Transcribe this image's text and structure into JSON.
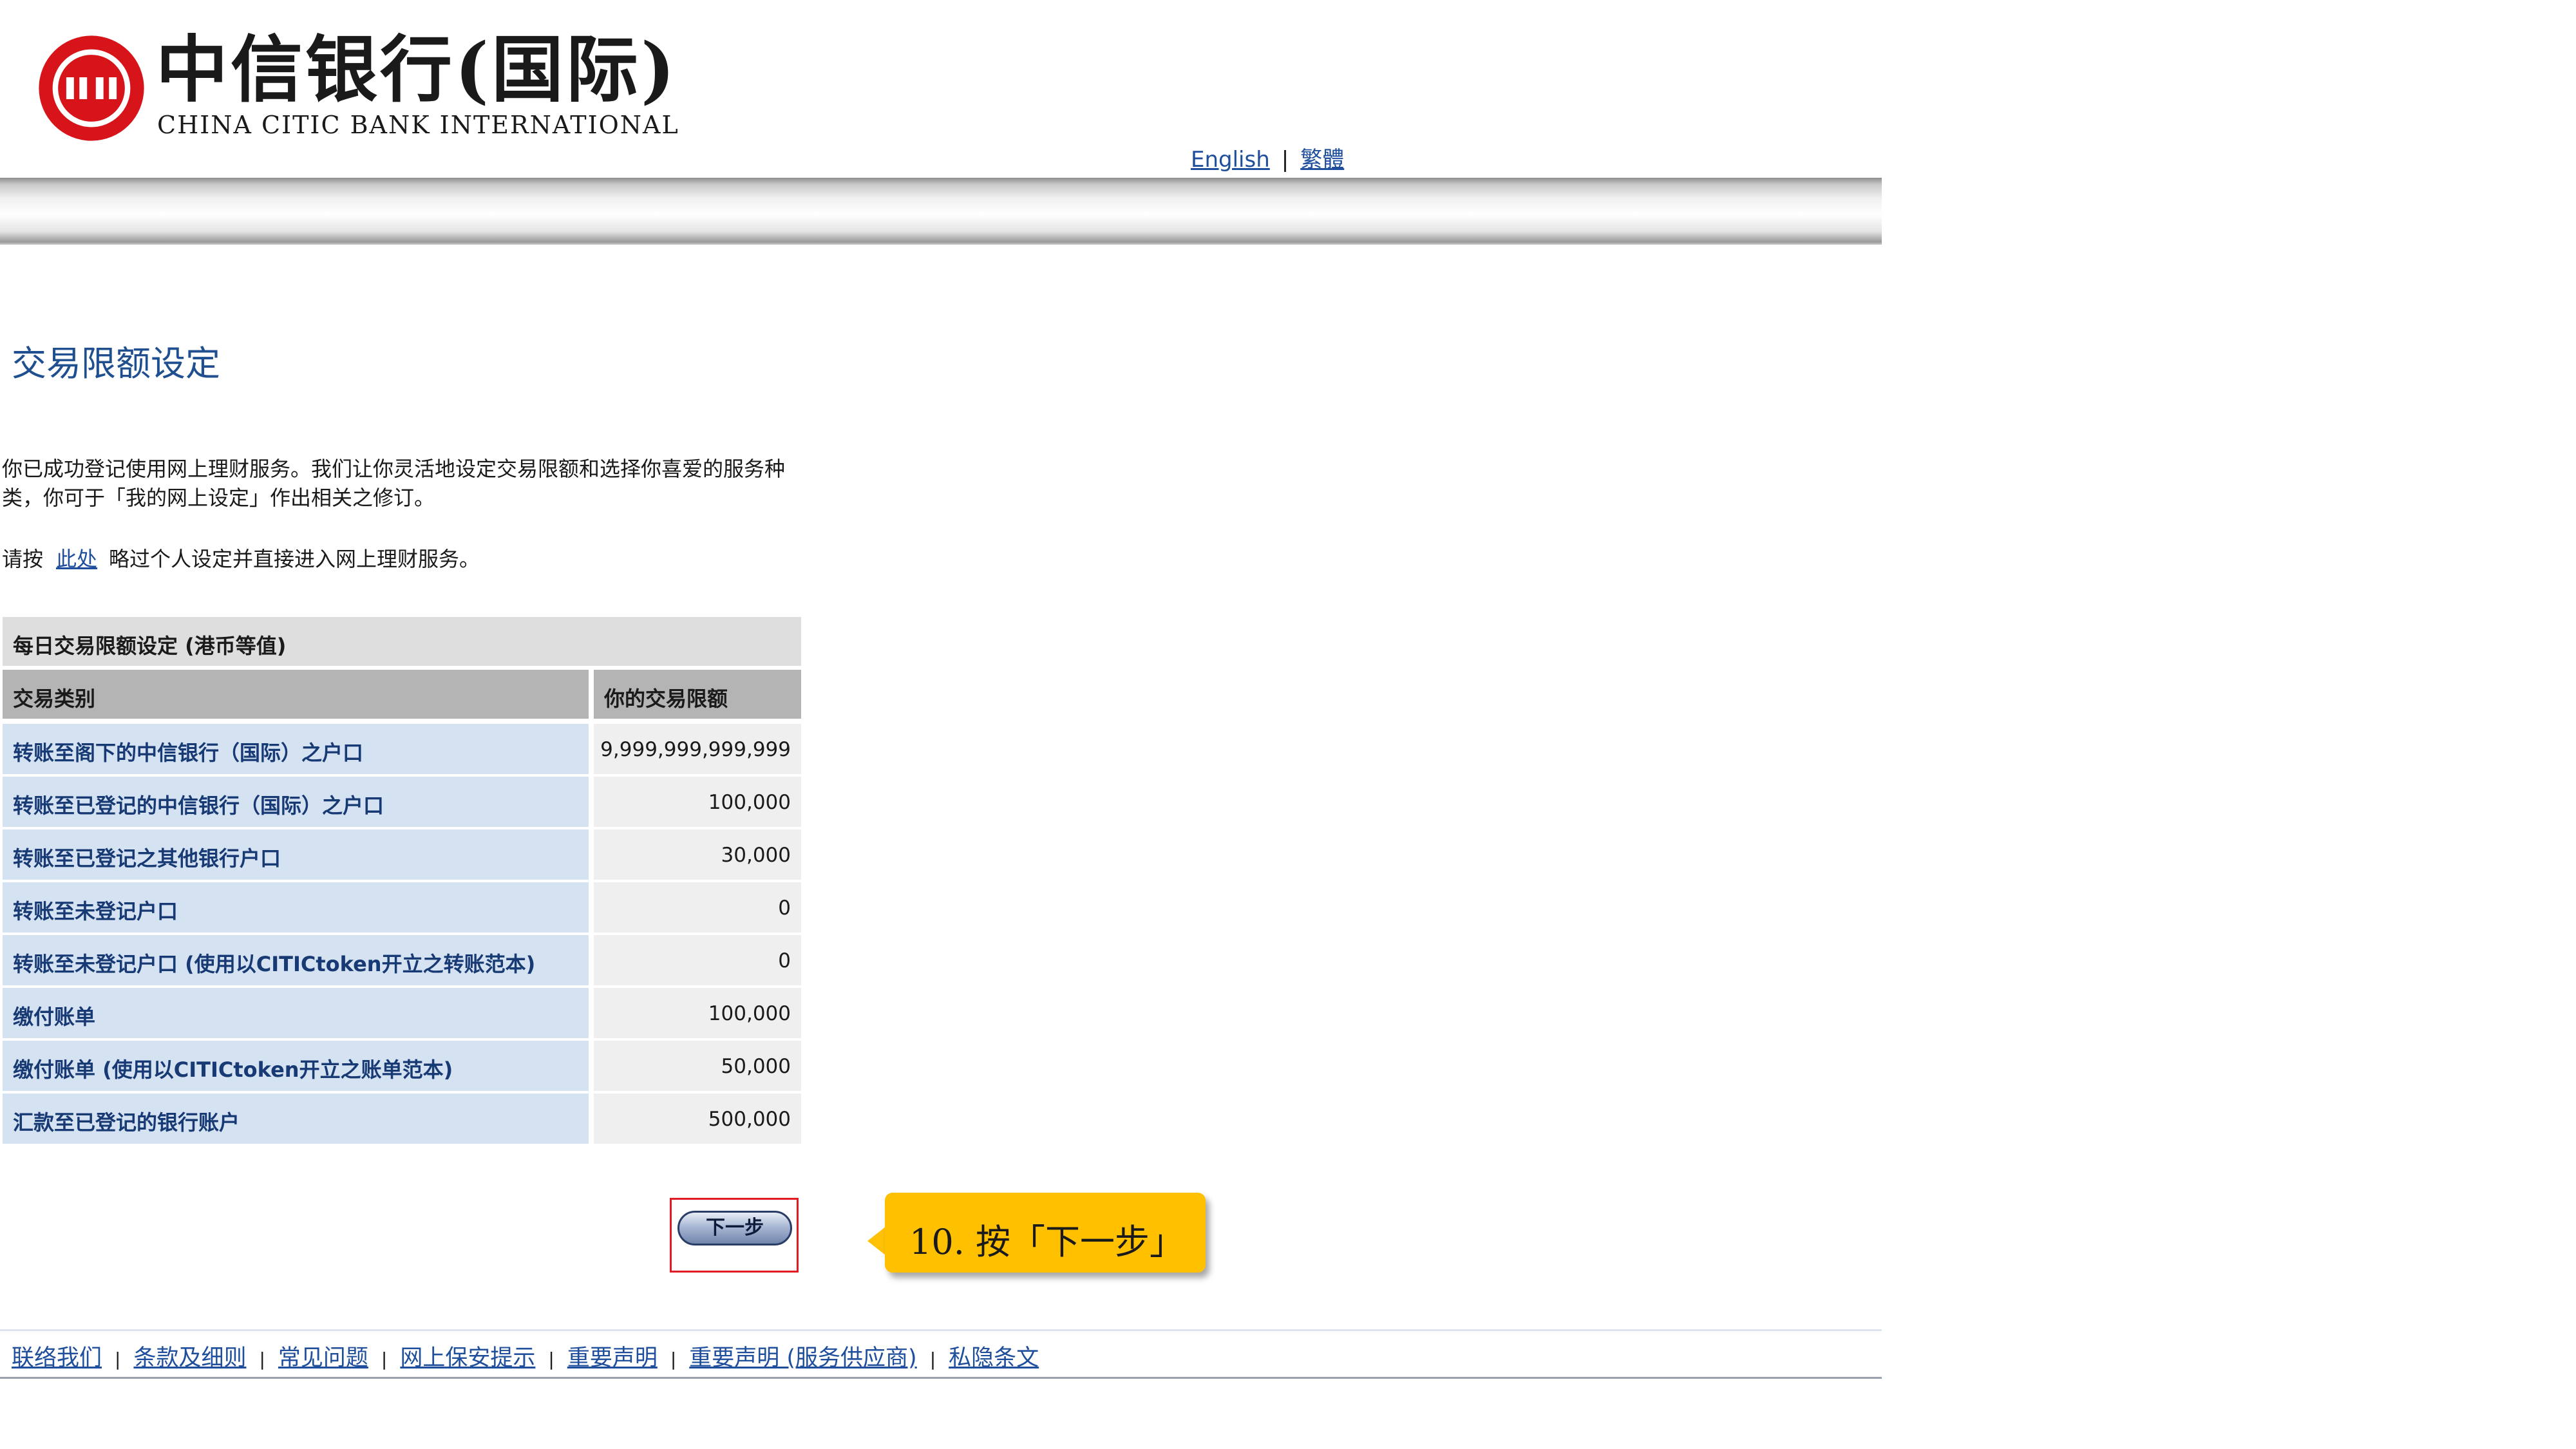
{
  "brand": {
    "name_cn": "中信银行(国际)",
    "name_en": "CHINA CITIC BANK INTERNATIONAL",
    "logo_icon": "citic-logo-icon",
    "color": "#d7141a"
  },
  "lang": {
    "english": "English",
    "traditional": "繁體",
    "separator": "|"
  },
  "page": {
    "title": "交易限额设定",
    "intro": "你已成功登记使用网上理财服务。我们让你灵活地设定交易限额和选择你喜爱的服务种类，你可于「我的网上设定」作出相关之修订。",
    "skip_prefix": "请按",
    "skip_link": "此处",
    "skip_suffix": "略过个人设定并直接进入网上理财服务。"
  },
  "table": {
    "caption": "每日交易限额设定 (港币等值)",
    "col_type": "交易类别",
    "col_limit": "你的交易限额",
    "rows": [
      {
        "type": "转账至阁下的中信银行（国际）之户口",
        "limit": "9,999,999,999,999"
      },
      {
        "type": "转账至已登记的中信银行（国际）之户口",
        "limit": "100,000"
      },
      {
        "type": "转账至已登记之其他银行户口",
        "limit": "30,000"
      },
      {
        "type": "转账至未登记户口",
        "limit": "0"
      },
      {
        "type": "转账至未登记户口 (使用以CITICtoken开立之转账范本)",
        "limit": "0"
      },
      {
        "type": "缴付账单",
        "limit": "100,000"
      },
      {
        "type": "缴付账单 (使用以CITICtoken开立之账单范本)",
        "limit": "50,000"
      },
      {
        "type": "汇款至已登记的银行账户",
        "limit": "500,000"
      }
    ]
  },
  "next_button": "下一步",
  "callout": "10. 按「下一步」",
  "footer": {
    "links": [
      "联络我们",
      "条款及细则",
      "常见问题",
      "网上保安提示",
      "重要声明",
      "重要声明 (服务供应商)",
      "私隐条文"
    ],
    "separator": "|"
  },
  "colors": {
    "title": "#1f4f8f",
    "link": "#1f4f9c",
    "row_label_bg": "#d5e2f2",
    "row_value_bg": "#efefef",
    "callout": "#ffc000",
    "highlight": "#e01b24"
  }
}
